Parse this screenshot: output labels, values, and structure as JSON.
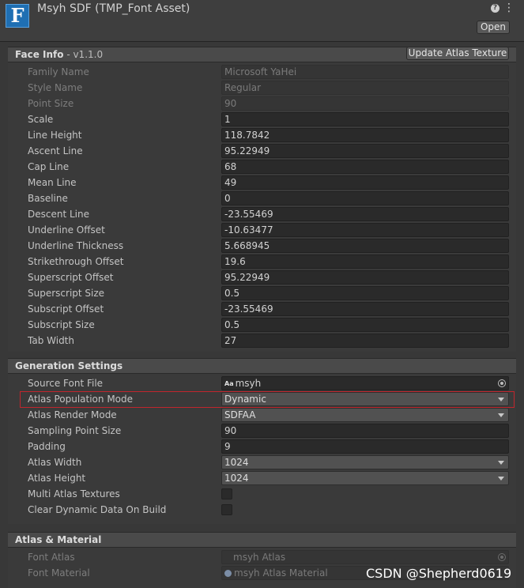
{
  "header": {
    "icon_letter": "F",
    "title": "Msyh SDF (TMP_Font Asset)",
    "help_glyph": "?",
    "menu_glyph": "⋮",
    "open_label": "Open"
  },
  "face_info": {
    "title": "Face Info",
    "version": " - v1.1.0",
    "update_label": "Update Atlas Texture",
    "rows": [
      {
        "label": "Family Name",
        "value": "Microsoft YaHei"
      },
      {
        "label": "Style Name",
        "value": "Regular"
      },
      {
        "label": "Point Size",
        "value": "90"
      },
      {
        "label": "Scale",
        "value": "1"
      },
      {
        "label": "Line Height",
        "value": "118.7842"
      },
      {
        "label": "Ascent Line",
        "value": "95.22949"
      },
      {
        "label": "Cap Line",
        "value": "68"
      },
      {
        "label": "Mean Line",
        "value": "49"
      },
      {
        "label": "Baseline",
        "value": "0"
      },
      {
        "label": "Descent Line",
        "value": "-23.55469"
      },
      {
        "label": "Underline Offset",
        "value": "-10.63477"
      },
      {
        "label": "Underline Thickness",
        "value": "5.668945"
      },
      {
        "label": "Strikethrough Offset",
        "value": "19.6"
      },
      {
        "label": "Superscript Offset",
        "value": "95.22949"
      },
      {
        "label": "Superscript Size",
        "value": "0.5"
      },
      {
        "label": "Subscript Offset",
        "value": "-23.55469"
      },
      {
        "label": "Subscript Size",
        "value": "0.5"
      },
      {
        "label": "Tab Width",
        "value": "27"
      }
    ]
  },
  "generation": {
    "title": "Generation Settings",
    "source_font_file": {
      "label": "Source Font File",
      "icon_text": "Aa",
      "value": "msyh"
    },
    "atlas_population_mode": {
      "label": "Atlas Population Mode",
      "value": "Dynamic"
    },
    "atlas_render_mode": {
      "label": "Atlas Render Mode",
      "value": "SDFAA"
    },
    "sampling_point_size": {
      "label": "Sampling Point Size",
      "value": "90"
    },
    "padding": {
      "label": "Padding",
      "value": "9"
    },
    "atlas_width": {
      "label": "Atlas Width",
      "value": "1024"
    },
    "atlas_height": {
      "label": "Atlas Height",
      "value": "1024"
    },
    "multi_atlas_textures": {
      "label": "Multi Atlas Textures",
      "checked": false
    },
    "clear_dynamic_data": {
      "label": "Clear Dynamic Data On Build",
      "checked": false
    }
  },
  "atlas_material": {
    "title": "Atlas & Material",
    "font_atlas": {
      "label": "Font Atlas",
      "value": "msyh Atlas"
    },
    "font_material": {
      "label": "Font Material",
      "value": "msyh Atlas Material"
    }
  },
  "watermark": "CSDN @Shepherd0619",
  "colors": {
    "highlight_border": "#c0262d",
    "icon_blue": "#1f6fb3"
  }
}
